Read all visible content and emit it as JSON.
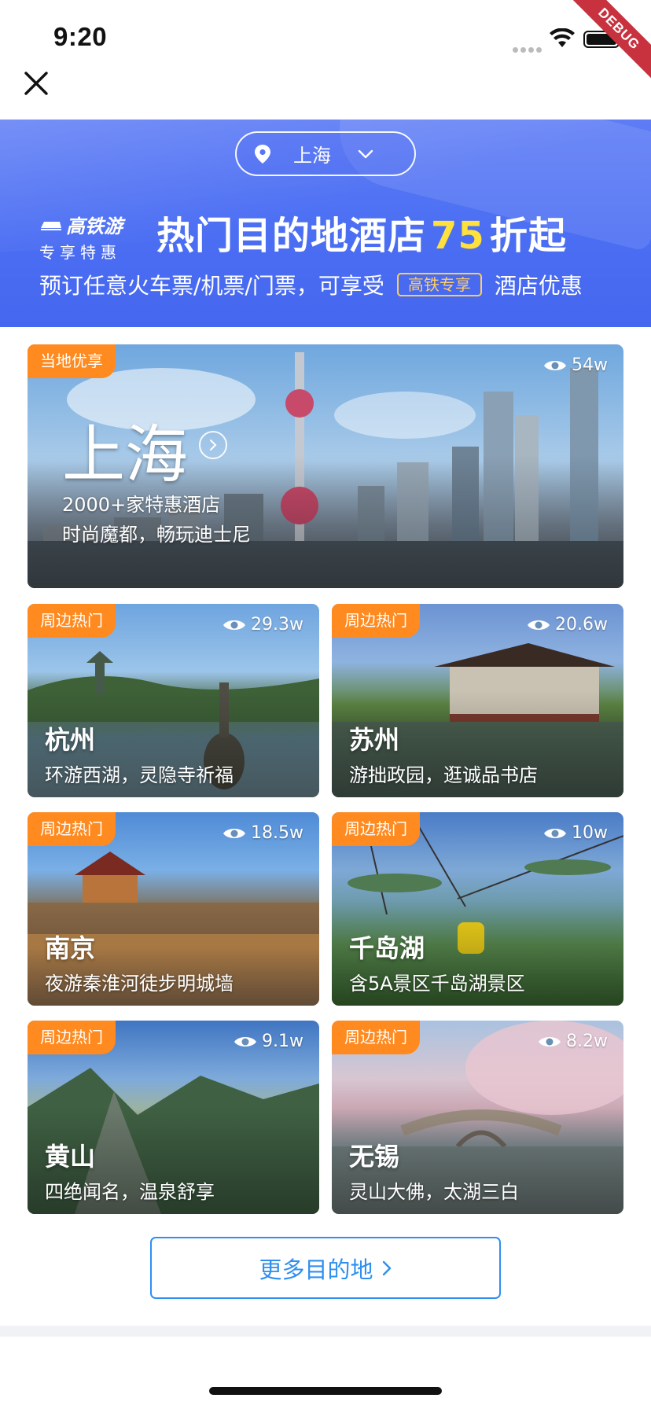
{
  "status_bar": {
    "time": "9:20",
    "debug_label": "DEBUG"
  },
  "nav": {
    "close_icon": "close-icon"
  },
  "banner": {
    "city": "上海",
    "brand_line1": "高铁游",
    "brand_line2": "专享特惠",
    "headline_prefix": "热门目的地酒店",
    "headline_number": "75",
    "headline_suffix": "折起",
    "sub_prefix": "预订任意火车票/机票/门票，可享受",
    "sub_tag": "高铁专享",
    "sub_suffix": "酒店优惠",
    "colors": {
      "background": "#4b6ef3",
      "highlight": "#ffe03c",
      "tag": "#ffcc66"
    }
  },
  "featured": {
    "tag": "当地优享",
    "views": "54w",
    "city": "上海",
    "stat": "2000+家特惠酒店",
    "desc": "时尚魔都，畅玩迪士尼"
  },
  "destinations": [
    {
      "tag": "周边热门",
      "views": "29.3w",
      "city": "杭州",
      "desc": "环游西湖，灵隐寺祈福"
    },
    {
      "tag": "周边热门",
      "views": "20.6w",
      "city": "苏州",
      "desc": "游拙政园，逛诚品书店"
    },
    {
      "tag": "周边热门",
      "views": "18.5w",
      "city": "南京",
      "desc": "夜游秦淮河徒步明城墙"
    },
    {
      "tag": "周边热门",
      "views": "10w",
      "city": "千岛湖",
      "desc": "含5A景区千岛湖景区"
    },
    {
      "tag": "周边热门",
      "views": "9.1w",
      "city": "黄山",
      "desc": "四绝闻名，温泉舒享"
    },
    {
      "tag": "周边热门",
      "views": "8.2w",
      "city": "无锡",
      "desc": "灵山大佛，太湖三白"
    }
  ],
  "more_button": {
    "label": "更多目的地"
  },
  "colors": {
    "tag": "#ff8a1f",
    "link": "#2e8ff0"
  }
}
